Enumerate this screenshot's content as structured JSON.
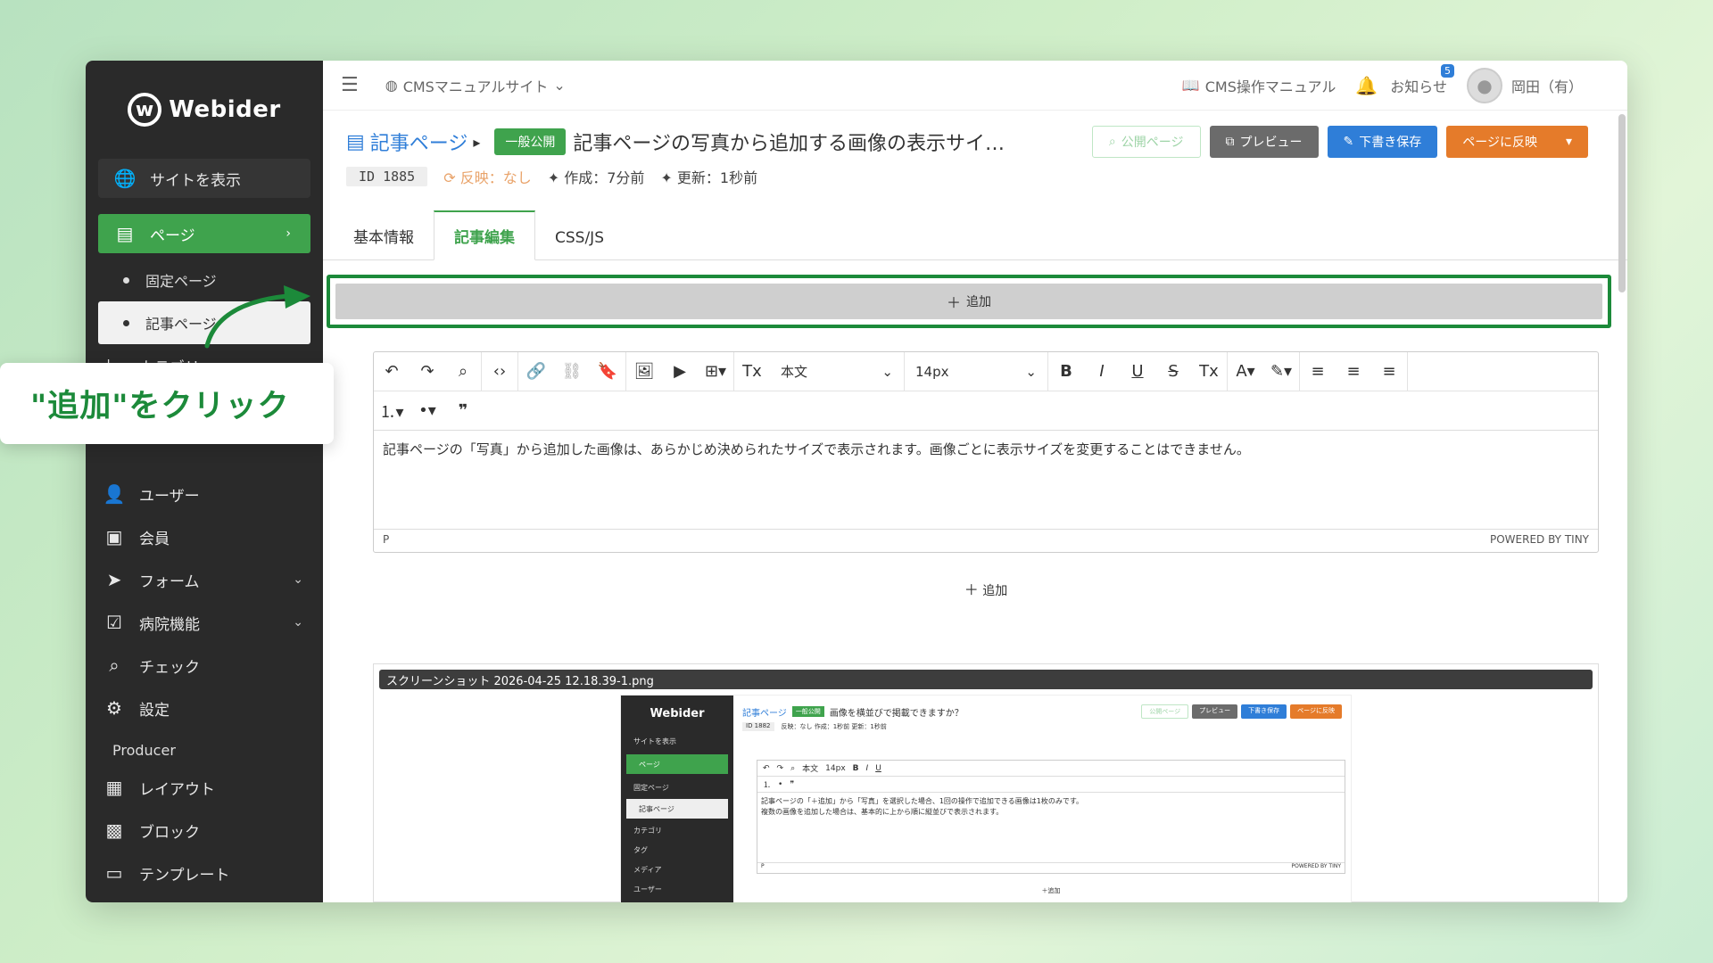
{
  "brand": {
    "name": "Webider"
  },
  "sidebar": {
    "site_button": "サイトを表示",
    "items": [
      {
        "label": "ページ"
      },
      {
        "label": "固定ページ"
      },
      {
        "label": "記事ページ"
      },
      {
        "label": "カテゴリ"
      },
      {
        "label": "ユーザー"
      },
      {
        "label": "会員"
      },
      {
        "label": "フォーム"
      },
      {
        "label": "病院機能"
      },
      {
        "label": "チェック"
      },
      {
        "label": "設定"
      }
    ],
    "producer_heading": "Producer",
    "producer_items": [
      {
        "label": "レイアウト"
      },
      {
        "label": "ブロック"
      },
      {
        "label": "テンプレート"
      }
    ]
  },
  "topbar": {
    "site_name": "CMSマニュアルサイト",
    "manual_link": "CMS操作マニュアル",
    "notifications_label": "お知らせ",
    "notifications_count": "5",
    "user_name": "岡田（有）"
  },
  "page": {
    "breadcrumb": "記事ページ",
    "status_badge": "一般公開",
    "title": "記事ページの写真から追加する画像の表示サイ…",
    "id": "ID 1885",
    "reflect": "反映：なし",
    "created": "作成：7分前",
    "updated": "更新：1秒前"
  },
  "actions": {
    "public_page": "公開ページ",
    "preview": "プレビュー",
    "draft_save": "下書き保存",
    "apply": "ページに反映"
  },
  "tabs": [
    "基本情報",
    "記事編集",
    "CSS/JS"
  ],
  "add_label": "追加",
  "editor": {
    "format_select": "本文",
    "size_select": "14px",
    "content": "記事ページの「写真」から追加した画像は、あらかじめ決められたサイズで表示されます。画像ごとに表示サイズを変更することはできません。",
    "status_path": "P",
    "powered": "POWERED BY TINY"
  },
  "image_block": {
    "caption": "スクリーンショット 2026-04-25 12.18.39-1.png",
    "mini": {
      "brand": "Webider",
      "site": "サイトを表示",
      "page": "ページ",
      "fixed": "固定ページ",
      "article": "記事ページ",
      "category": "カテゴリ",
      "tag": "タグ",
      "media": "メディア",
      "user": "ユーザー",
      "crumb": "記事ページ",
      "badge": "一般公開",
      "title": "画像を横並びで掲載できますか？",
      "id": "ID 1882",
      "meta": "反映：なし  作成：1秒前  更新：1秒前",
      "btn_public": "公開ページ",
      "btn_preview": "プレビュー",
      "btn_draft": "下書き保存",
      "btn_apply": "ページに反映",
      "line1": "記事ページの「＋追加」から「写真」を選択した場合、1回の操作で追加できる画像は1枚のみです。",
      "line2": "複数の画像を追加した場合は、基本的に上から順に縦並びで表示されます。",
      "format": "本文",
      "size": "14px",
      "status": "P",
      "powered": "POWERED BY TINY",
      "add": "＋追加"
    }
  },
  "callout": {
    "text": "\"追加\"をクリック"
  },
  "colors": {
    "accent_green": "#3fa34d",
    "highlight_green": "#1c8a3a",
    "blue": "#2f7ed8",
    "orange": "#e57b2a",
    "sidebar_bg": "#2a2a2a"
  }
}
